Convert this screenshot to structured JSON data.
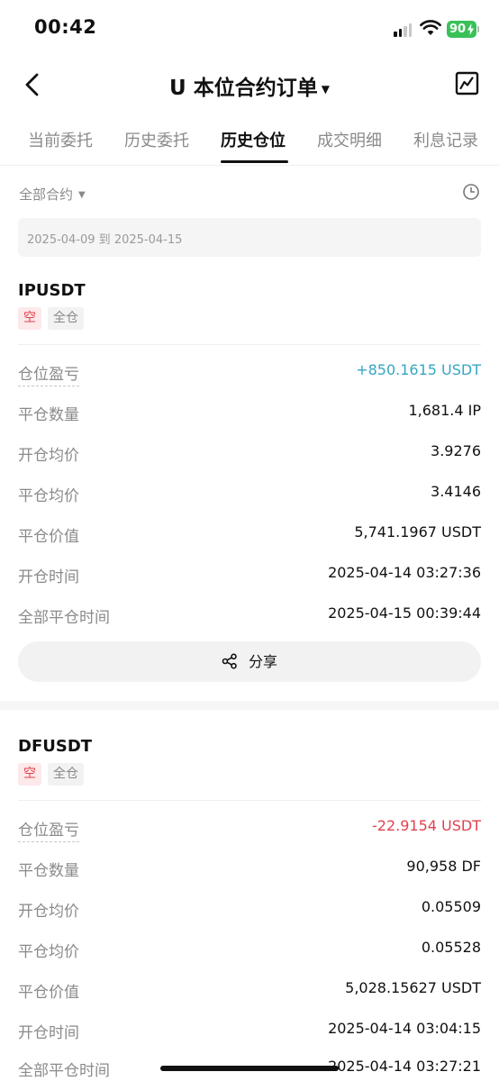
{
  "status_bar": {
    "time": "00:42",
    "battery": "90"
  },
  "nav": {
    "title": "U 本位合约订单",
    "caret": "▼"
  },
  "tabs": [
    {
      "label": "当前委托"
    },
    {
      "label": "历史委托"
    },
    {
      "label": "历史仓位",
      "active": true
    },
    {
      "label": "成交明细"
    },
    {
      "label": "利息记录"
    }
  ],
  "filter": {
    "contract_label": "全部合约",
    "caret": "▼",
    "date_range": "2025-04-09 到 2025-04-15"
  },
  "positions": [
    {
      "symbol": "IPUSDT",
      "side": "空",
      "margin_mode": "全仓",
      "pnl_label": "仓位盈亏",
      "pnl_value": "+850.1615 USDT",
      "close_qty_label": "平仓数量",
      "close_qty_value": "1,681.4 IP",
      "open_avg_label": "开仓均价",
      "open_avg_value": "3.9276",
      "close_avg_label": "平仓均价",
      "close_avg_value": "3.4146",
      "close_value_label": "平仓价值",
      "close_value_value": "5,741.1967 USDT",
      "open_time_label": "开仓时间",
      "open_time_value": "2025-04-14 03:27:36",
      "full_close_time_label": "全部平仓时间",
      "full_close_time_value": "2025-04-15 00:39:44",
      "share_label": "分享"
    },
    {
      "symbol": "DFUSDT",
      "side": "空",
      "margin_mode": "全仓",
      "pnl_label": "仓位盈亏",
      "pnl_value": "-22.9154 USDT",
      "close_qty_label": "平仓数量",
      "close_qty_value": "90,958 DF",
      "open_avg_label": "开仓均价",
      "open_avg_value": "0.05509",
      "close_avg_label": "平仓均价",
      "close_avg_value": "0.05528",
      "close_value_label": "平仓价值",
      "close_value_value": "5,028.15627 USDT",
      "open_time_label": "开仓时间",
      "open_time_value": "2025-04-14 03:04:15",
      "full_close_time_label": "全部平仓时间",
      "full_close_time_value": "2025-04-14 03:27:21"
    }
  ],
  "colors": {
    "profit": "#35a6c4",
    "loss": "#e0424f",
    "battery": "#39c158"
  }
}
